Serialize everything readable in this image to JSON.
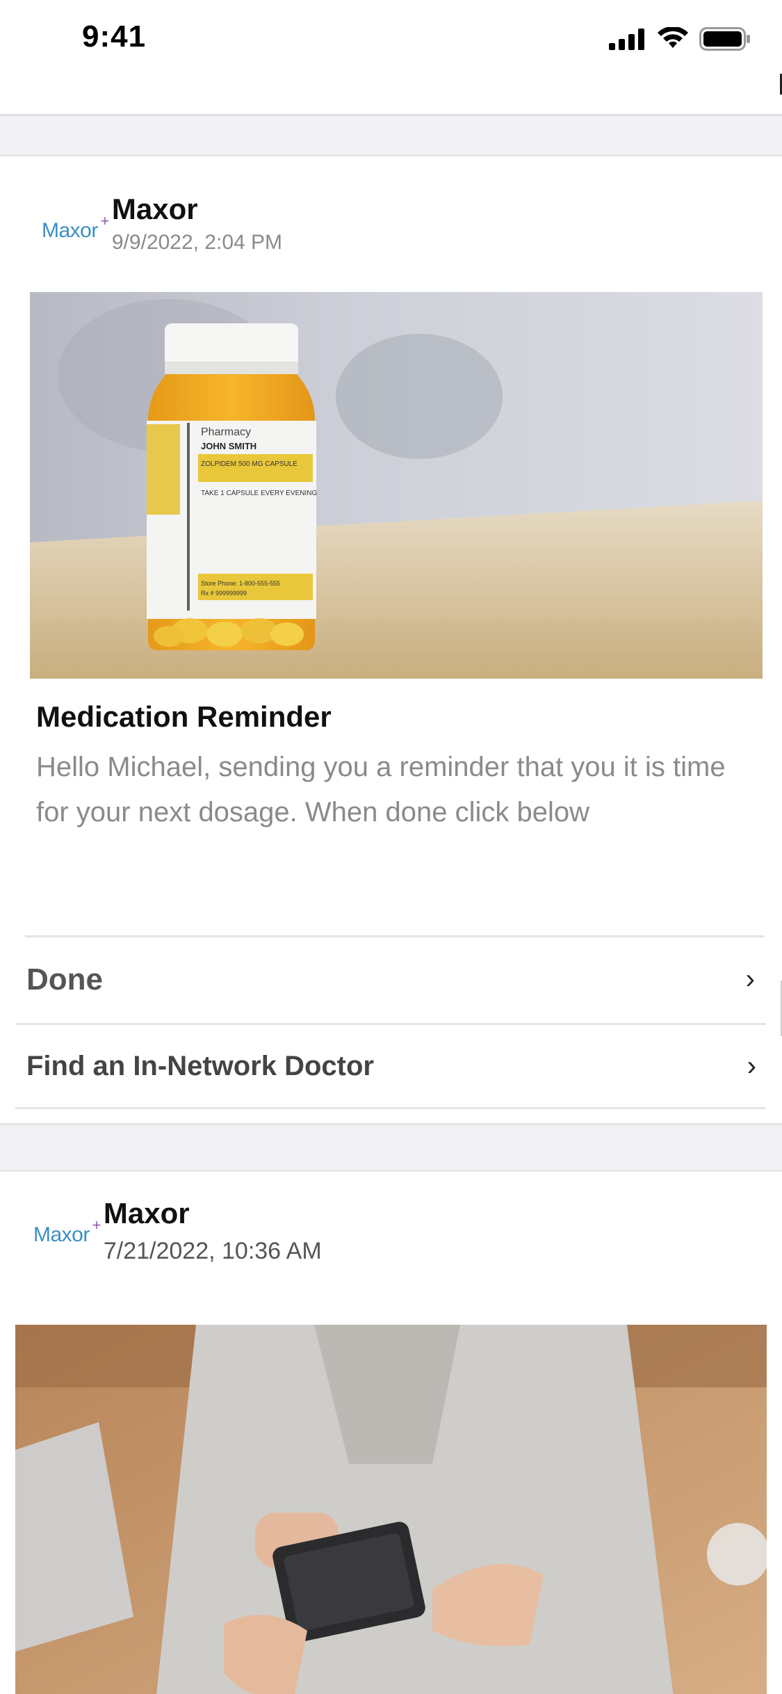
{
  "status_bar": {
    "time": "9:41",
    "icons": [
      "signal-icon",
      "wifi-icon",
      "battery-icon"
    ]
  },
  "colors": {
    "brand_blue": "#3c8fc4",
    "brand_purple": "#8a5fa8",
    "muted_text": "#8a8a8e",
    "divider": "#e4e4e8"
  },
  "messages": [
    {
      "sender": "Maxor",
      "logo_text": "Maxor",
      "logo_mark": "+",
      "date": "9/9/2022, 2:04 PM",
      "image": "pharmacy-bottle-image",
      "bottle_label": {
        "brand": "Pharmacy",
        "patient": "JOHN SMITH",
        "drug": "ZOLPIDEM 500 MG CAPSULE",
        "instructions": "TAKE 1 CAPSULE EVERY EVENING",
        "phone": "Store Phone: 1-800-555-555",
        "rx": "Rx # 999999999"
      },
      "title": "Medication Reminder",
      "body": "Hello Michael, sending you a reminder that you it is time for your next dosage. When done click below",
      "actions": [
        {
          "label": "Done",
          "icon": "chevron-right-icon"
        },
        {
          "label": "Find an In-Network Doctor",
          "icon": "chevron-right-icon"
        }
      ]
    },
    {
      "sender": "Maxor",
      "logo_text": "Maxor",
      "logo_mark": "+",
      "date": "7/21/2022, 10:36 AM",
      "image": "person-holding-phone-image"
    }
  ]
}
